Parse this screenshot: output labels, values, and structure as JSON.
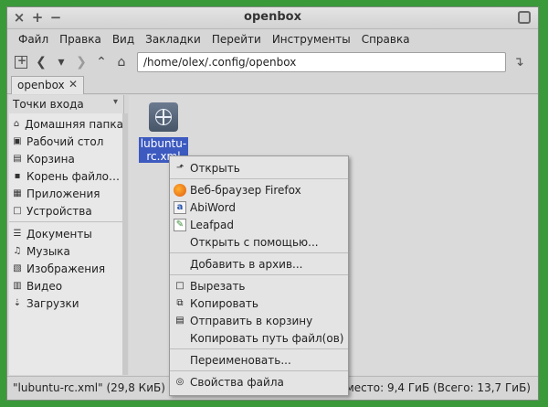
{
  "window": {
    "title": "openbox",
    "btn_close": "×",
    "btn_max": "+",
    "btn_min": "−"
  },
  "menubar": [
    "Файл",
    "Правка",
    "Вид",
    "Закладки",
    "Перейти",
    "Инструменты",
    "Справка"
  ],
  "toolbar": {
    "path": "/home/olex/.config/openbox"
  },
  "tab": {
    "label": "openbox",
    "close": "✕"
  },
  "side": {
    "header": "Точки входа",
    "places": [
      {
        "label": "Домашняя папка",
        "icon": "home-icon"
      },
      {
        "label": "Рабочий стол",
        "icon": "desktop-icon"
      },
      {
        "label": "Корзина",
        "icon": "trash-icon"
      },
      {
        "label": "Корень файло…",
        "icon": "drive-icon"
      },
      {
        "label": "Приложения",
        "icon": "apps-icon"
      },
      {
        "label": "Устройства",
        "icon": "devices-icon"
      }
    ],
    "bookmarks": [
      {
        "label": "Документы",
        "icon": "documents-icon"
      },
      {
        "label": "Музыка",
        "icon": "music-icon"
      },
      {
        "label": "Изображения",
        "icon": "images-icon"
      },
      {
        "label": "Видео",
        "icon": "video-icon"
      },
      {
        "label": "Загрузки",
        "icon": "downloads-icon"
      }
    ]
  },
  "file": {
    "label_line1": "lubuntu-",
    "label_line2": "rc.xml"
  },
  "status": {
    "left": "\"lubuntu-rc.xml\" (29,8 КиБ) до",
    "right": "е место: 9,4 ГиБ (Всего: 13,7 ГиБ)"
  },
  "context_menu": {
    "open": "Открыть",
    "firefox": "Веб-браузер Firefox",
    "abiword": "AbiWord",
    "leafpad": "Leafpad",
    "open_with": "Открыть с помощью...",
    "add_archive": "Добавить в архив...",
    "cut": "Вырезать",
    "copy": "Копировать",
    "trash": "Отправить в корзину",
    "copy_path": "Копировать путь файл(ов)",
    "rename": "Переименовать...",
    "properties": "Свойства файла"
  }
}
